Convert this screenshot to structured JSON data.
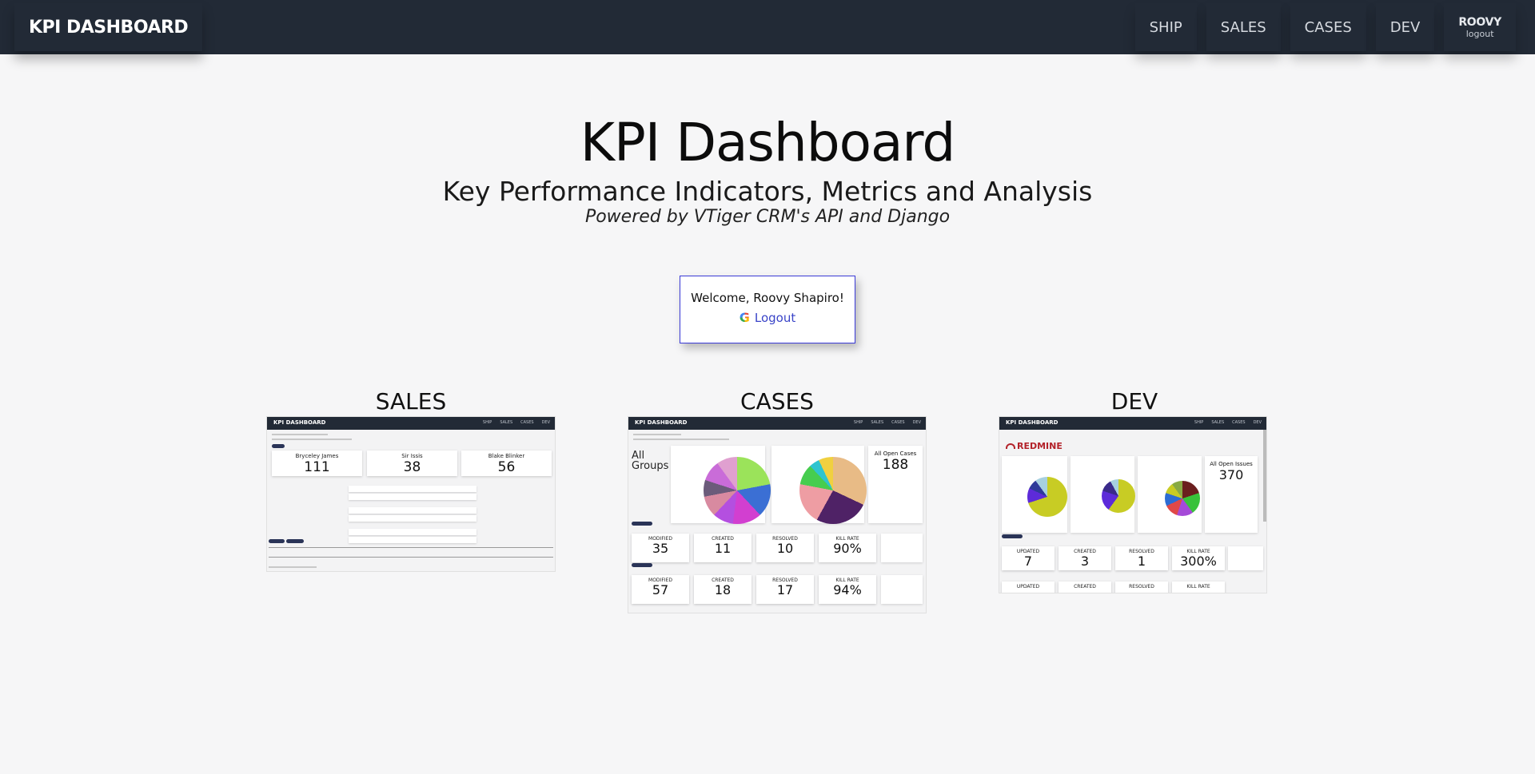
{
  "nav": {
    "brand": "KPI DASHBOARD",
    "links": [
      "SHIP",
      "SALES",
      "CASES",
      "DEV"
    ],
    "user_name": "ROOVY",
    "user_logout": "logout"
  },
  "hero": {
    "title": "KPI Dashboard",
    "subtitle": "Key Performance Indicators, Metrics and Analysis",
    "powered": "Powered by VTiger CRM's API and Django"
  },
  "welcome": {
    "message": "Welcome, Roovy Shapiro!",
    "logout": "Logout",
    "icon": "google-g-icon"
  },
  "sections": {
    "sales": {
      "label": "SALES",
      "cards": [
        {
          "name": "Bryceley James",
          "value": "111"
        },
        {
          "name": "Sir Issis",
          "value": "38"
        },
        {
          "name": "Blake Blinker",
          "value": "56"
        }
      ]
    },
    "cases": {
      "label": "CASES",
      "groups_label": "All\nGroups",
      "open_label": "All Open Cases",
      "open_value": "188",
      "today": [
        {
          "label": "MODIFIED",
          "value": "35"
        },
        {
          "label": "CREATED",
          "value": "11"
        },
        {
          "label": "RESOLVED",
          "value": "10"
        },
        {
          "label": "KILL RATE",
          "value": "90%"
        }
      ],
      "week": [
        {
          "label": "MODIFIED",
          "value": "57"
        },
        {
          "label": "CREATED",
          "value": "18"
        },
        {
          "label": "RESOLVED",
          "value": "17"
        },
        {
          "label": "KILL RATE",
          "value": "94%"
        }
      ]
    },
    "dev": {
      "label": "DEV",
      "logo": "REDMINE",
      "open_label": "All Open Issues",
      "open_value": "370",
      "today": [
        {
          "label": "UPDATED",
          "value": "7"
        },
        {
          "label": "CREATED",
          "value": "3"
        },
        {
          "label": "RESOLVED",
          "value": "1"
        },
        {
          "label": "KILL RATE",
          "value": "300%"
        }
      ],
      "week": [
        {
          "label": "UPDATED",
          "value": ""
        },
        {
          "label": "CREATED",
          "value": ""
        },
        {
          "label": "RESOLVED",
          "value": ""
        },
        {
          "label": "KILL RATE",
          "value": ""
        }
      ]
    }
  },
  "colors": {
    "navbar": "#222a36",
    "background": "#f6f6f7",
    "welcome_border": "#3a3ad6",
    "link": "#3a44c8"
  }
}
